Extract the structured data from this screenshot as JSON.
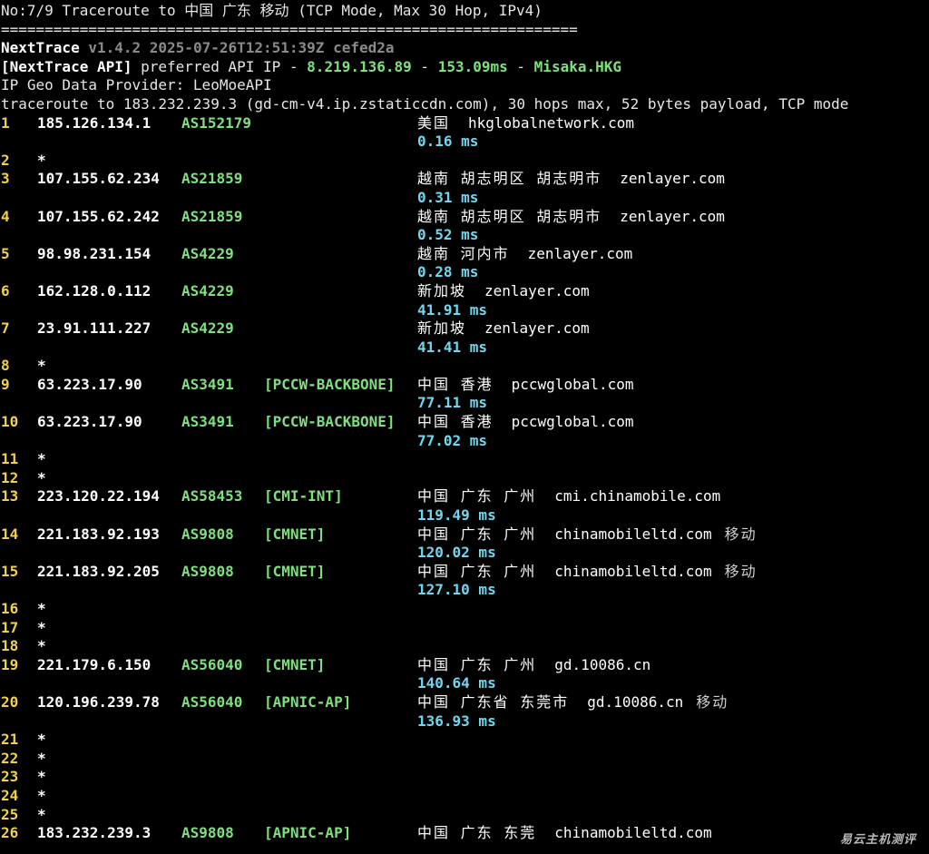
{
  "header": {
    "title": "No:7/9 Traceroute to 中国 广东 移动 (TCP Mode, Max 30 Hop, IPv4)",
    "rule": "==================================================================",
    "app_name": "NextTrace",
    "version": "v1.4.2 2025-07-26T12:51:39Z cefed2a",
    "api_label": "[NextTrace API]",
    "api_text": "preferred API IP -",
    "api_ip": "8.219.136.89",
    "api_sep1": "-",
    "api_latency": "153.09ms",
    "api_sep2": "-",
    "api_node": "Misaka.HKG",
    "geo_provider": "IP Geo Data Provider: LeoMoeAPI",
    "traceroute_line": "traceroute to 183.232.239.3 (gd-cm-v4.ip.zstaticcdn.com), 30 hops max, 52 bytes payload, TCP mode"
  },
  "hops": [
    {
      "n": "1",
      "ip": "185.126.134.1",
      "as": "AS152179",
      "tag": "",
      "loc": "美国",
      "host": "hkglobalnetwork.com",
      "isp": "",
      "time": "0.16 ms"
    },
    {
      "n": "2",
      "ip": "*"
    },
    {
      "n": "3",
      "ip": "107.155.62.234",
      "as": "AS21859",
      "tag": "",
      "loc": "越南 胡志明区 胡志明市",
      "host": "zenlayer.com",
      "isp": "",
      "time": "0.31 ms"
    },
    {
      "n": "4",
      "ip": "107.155.62.242",
      "as": "AS21859",
      "tag": "",
      "loc": "越南 胡志明区 胡志明市",
      "host": "zenlayer.com",
      "isp": "",
      "time": "0.52 ms"
    },
    {
      "n": "5",
      "ip": "98.98.231.154",
      "as": "AS4229",
      "tag": "",
      "loc": "越南 河内市",
      "host": "zenlayer.com",
      "isp": "",
      "time": "0.28 ms"
    },
    {
      "n": "6",
      "ip": "162.128.0.112",
      "as": "AS4229",
      "tag": "",
      "loc": "新加坡",
      "host": "zenlayer.com",
      "isp": "",
      "time": "41.91 ms"
    },
    {
      "n": "7",
      "ip": "23.91.111.227",
      "as": "AS4229",
      "tag": "",
      "loc": "新加坡",
      "host": "zenlayer.com",
      "isp": "",
      "time": "41.41 ms"
    },
    {
      "n": "8",
      "ip": "*"
    },
    {
      "n": "9",
      "ip": "63.223.17.90",
      "as": "AS3491",
      "tag": "[PCCW-BACKBONE]",
      "loc": "中国 香港",
      "host": "pccwglobal.com",
      "isp": "",
      "time": "77.11 ms"
    },
    {
      "n": "10",
      "ip": "63.223.17.90",
      "as": "AS3491",
      "tag": "[PCCW-BACKBONE]",
      "loc": "中国 香港",
      "host": "pccwglobal.com",
      "isp": "",
      "time": "77.02 ms"
    },
    {
      "n": "11",
      "ip": "*"
    },
    {
      "n": "12",
      "ip": "*"
    },
    {
      "n": "13",
      "ip": "223.120.22.194",
      "as": "AS58453",
      "tag": "[CMI-INT]",
      "loc": "中国 广东 广州",
      "host": "cmi.chinamobile.com",
      "isp": "",
      "time": "119.49 ms"
    },
    {
      "n": "14",
      "ip": "221.183.92.193",
      "as": "AS9808",
      "tag": "[CMNET]",
      "loc": "中国 广东 广州",
      "host": "chinamobileltd.com",
      "isp": "移动",
      "time": "120.02 ms"
    },
    {
      "n": "15",
      "ip": "221.183.92.205",
      "as": "AS9808",
      "tag": "[CMNET]",
      "loc": "中国 广东 广州",
      "host": "chinamobileltd.com",
      "isp": "移动",
      "time": "127.10 ms"
    },
    {
      "n": "16",
      "ip": "*"
    },
    {
      "n": "17",
      "ip": "*"
    },
    {
      "n": "18",
      "ip": "*"
    },
    {
      "n": "19",
      "ip": "221.179.6.150",
      "as": "AS56040",
      "tag": "[CMNET]",
      "loc": "中国 广东 广州",
      "host": "gd.10086.cn",
      "isp": "",
      "time": "140.64 ms"
    },
    {
      "n": "20",
      "ip": "120.196.239.78",
      "as": "AS56040",
      "tag": "[APNIC-AP]",
      "loc": "中国 广东省 东莞市",
      "host": "gd.10086.cn",
      "isp": "移动",
      "time": "136.93 ms"
    },
    {
      "n": "21",
      "ip": "*"
    },
    {
      "n": "22",
      "ip": "*"
    },
    {
      "n": "23",
      "ip": "*"
    },
    {
      "n": "24",
      "ip": "*"
    },
    {
      "n": "25",
      "ip": "*"
    },
    {
      "n": "26",
      "ip": "183.232.239.3",
      "as": "AS9808",
      "tag": "[APNIC-AP]",
      "loc": "中国 广东 东莞",
      "host": "chinamobileltd.com",
      "isp": "",
      "time": ""
    }
  ],
  "watermark": "易云主机测评"
}
